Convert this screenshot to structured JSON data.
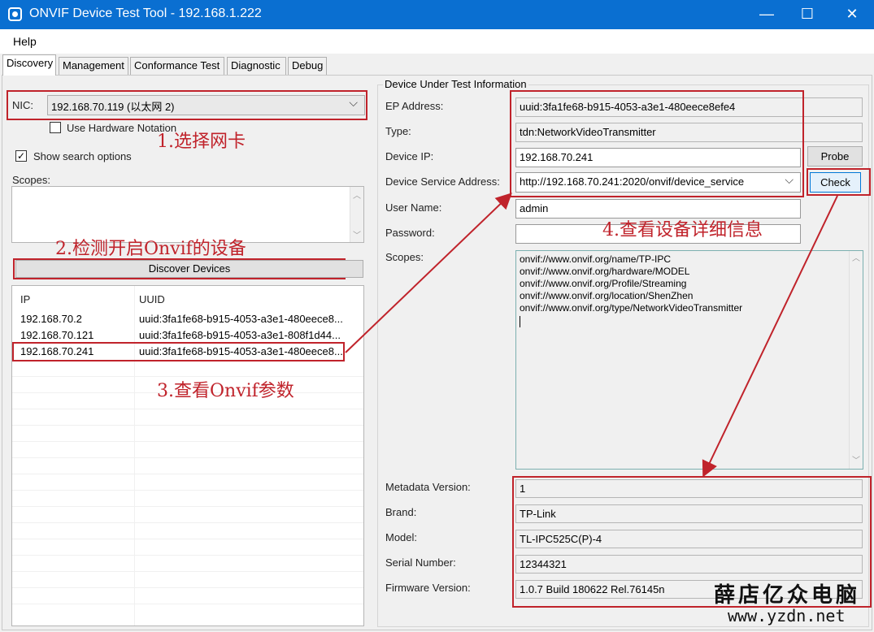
{
  "window": {
    "title": "ONVIF Device Test Tool - 192.168.1.222",
    "minimize": "—",
    "maximize": "☐",
    "close": "✕"
  },
  "menu": {
    "help": "Help"
  },
  "tabs": [
    "Discovery",
    "Management",
    "Conformance Test",
    "Diagnostic",
    "Debug"
  ],
  "discovery": {
    "nic_label": "NIC:",
    "nic_value": "192.168.70.119 (以太网 2)",
    "use_hw_notation": "Use Hardware Notation",
    "show_search_options": "Show search options",
    "scopes_label": "Scopes:",
    "discover_button": "Discover Devices",
    "columns": {
      "ip": "IP",
      "uuid": "UUID"
    },
    "devices": [
      {
        "ip": "192.168.70.2",
        "uuid": "uuid:3fa1fe68-b915-4053-a3e1-480eece8..."
      },
      {
        "ip": "192.168.70.121",
        "uuid": "uuid:3fa1fe68-b915-4053-a3e1-808f1d44..."
      },
      {
        "ip": "192.168.70.241",
        "uuid": "uuid:3fa1fe68-b915-4053-a3e1-480eece8..."
      }
    ]
  },
  "dut": {
    "group_title": "Device Under Test Information",
    "ep_label": "EP Address:",
    "ep_value": "uuid:3fa1fe68-b915-4053-a3e1-480eece8efe4",
    "type_label": "Type:",
    "type_value": "tdn:NetworkVideoTransmitter",
    "ip_label": "Device IP:",
    "ip_value": "192.168.70.241",
    "probe_button": "Probe",
    "service_label": "Device Service Address:",
    "service_value": "http://192.168.70.241:2020/onvif/device_service",
    "check_button": "Check",
    "user_label": "User Name:",
    "user_value": "admin",
    "password_label": "Password:",
    "password_value": "",
    "scopes_label": "Scopes:",
    "scopes": [
      "onvif://www.onvif.org/name/TP-IPC",
      "onvif://www.onvif.org/hardware/MODEL",
      "onvif://www.onvif.org/Profile/Streaming",
      "onvif://www.onvif.org/location/ShenZhen",
      "onvif://www.onvif.org/type/NetworkVideoTransmitter"
    ],
    "metadata_label": "Metadata Version:",
    "metadata_value": "1",
    "brand_label": "Brand:",
    "brand_value": "TP-Link",
    "model_label": "Model:",
    "model_value": "TL-IPC525C(P)-4",
    "serial_label": "Serial Number:",
    "serial_value": "12344321",
    "firmware_label": "Firmware Version:",
    "firmware_value": "1.0.7 Build 180622 Rel.76145n"
  },
  "annotations": {
    "step1": "1.选择网卡",
    "step2": "2.检测开启Onvif的设备",
    "step3": "3.查看Onvif参数",
    "step4": "4.查看设备详细信息"
  },
  "watermark": {
    "brand": "薛店亿众电脑",
    "url": "www.yzdn.net"
  },
  "colors": {
    "titlebar": "#0a6fd1",
    "annotation": "#c0232b"
  }
}
